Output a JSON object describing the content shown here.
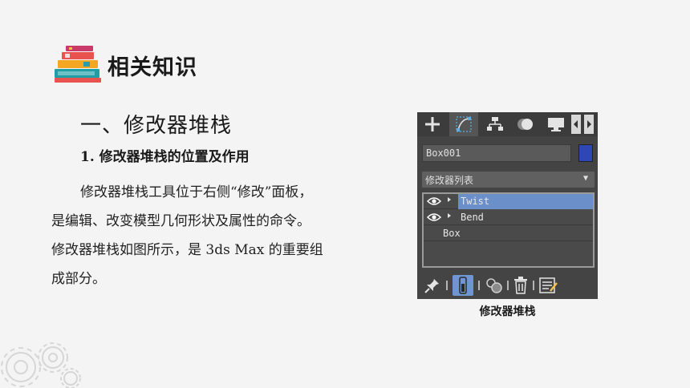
{
  "section_title": "相关知识",
  "heading": "一、修改器堆栈",
  "subheading": "1. 修改器堆栈的位置及作用",
  "paragraph_lines": [
    "修改器堆栈工具位于右侧“修改”面板，",
    "是编辑、改变模型几何形状及属性的命令。",
    "修改器堆栈如图所示，是 3ds Max 的重要组",
    "成部分。"
  ],
  "panel": {
    "tabs": [
      "create-icon",
      "modify-icon",
      "hierarchy-icon",
      "motion-icon",
      "display-icon"
    ],
    "object_name": "Box001",
    "object_color": "#2f47b5",
    "modifier_list_label": "修改器列表",
    "stack": [
      {
        "label": "Twist",
        "selected": true
      },
      {
        "label": "Bend",
        "selected": false
      }
    ],
    "base_object": "Box",
    "bottom_tools": [
      "pin-stack-icon",
      "show-end-result-icon",
      "make-unique-icon",
      "remove-modifier-icon",
      "configure-modifier-sets-icon"
    ],
    "highlight_color": "#6b8fc9"
  },
  "caption": "修改器堆栈"
}
